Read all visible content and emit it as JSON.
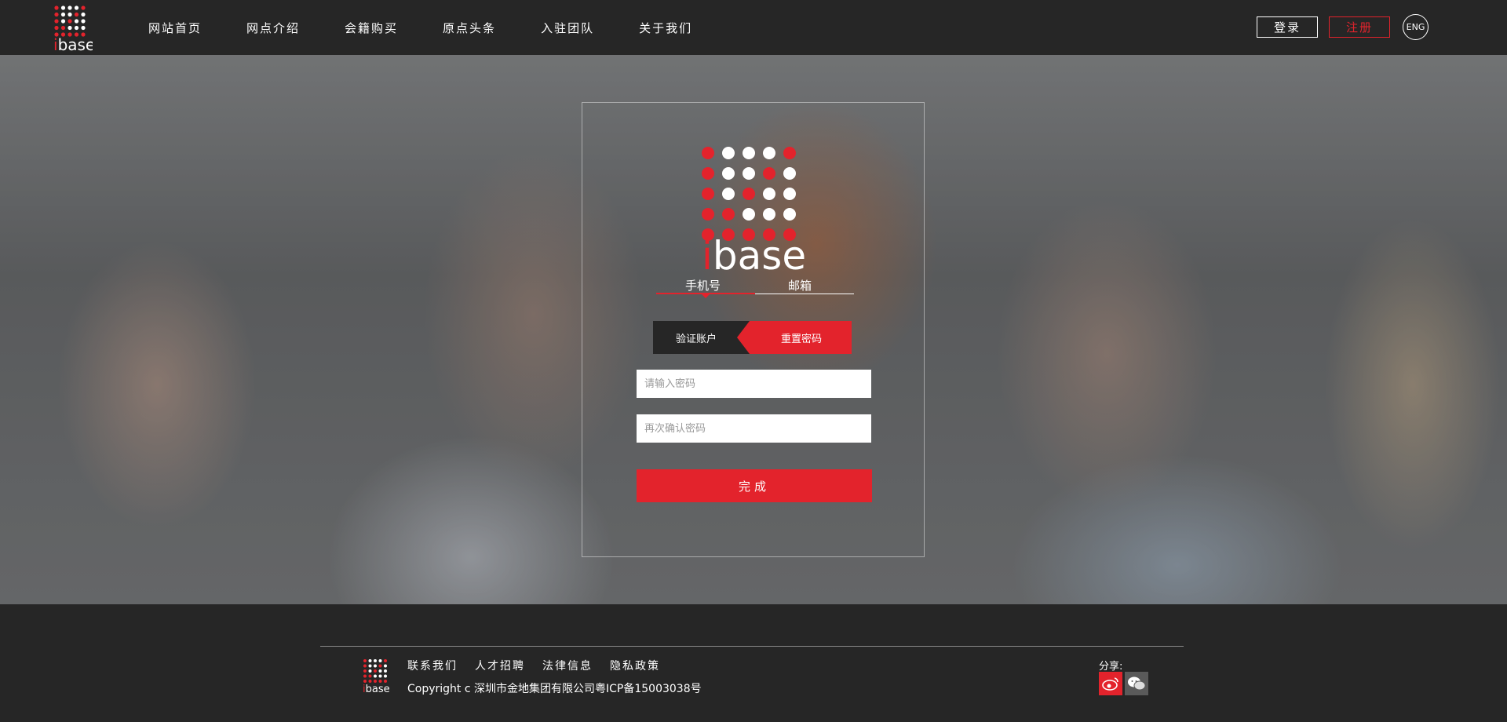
{
  "brand": {
    "logo_text": "ibase",
    "accent_color": "#e3232c",
    "dark_color": "#262626"
  },
  "nav": {
    "items": [
      {
        "label": "网站首页"
      },
      {
        "label": "网点介绍"
      },
      {
        "label": "会籍购买"
      },
      {
        "label": "原点头条"
      },
      {
        "label": "入驻团队"
      },
      {
        "label": "关于我们"
      }
    ],
    "login_label": "登录",
    "register_label": "注册",
    "lang_label": "ENG"
  },
  "reset": {
    "tabs": [
      {
        "label": "手机号",
        "active": true
      },
      {
        "label": "邮箱",
        "active": false
      }
    ],
    "steps": [
      {
        "label": "验证账户"
      },
      {
        "label": "重置密码",
        "active": true
      }
    ],
    "password_placeholder": "请输入密码",
    "confirm_placeholder": "再次确认密码",
    "submit_label": "完成"
  },
  "footer": {
    "links": [
      {
        "label": "联系我们"
      },
      {
        "label": "人才招聘"
      },
      {
        "label": "法律信息"
      },
      {
        "label": "隐私政策"
      }
    ],
    "copyright": "Copyright c 深圳市金地集团有限公司粤ICP备15003038号",
    "share_label": "分享:",
    "share_icons": [
      "weibo-icon",
      "wechat-icon"
    ]
  }
}
